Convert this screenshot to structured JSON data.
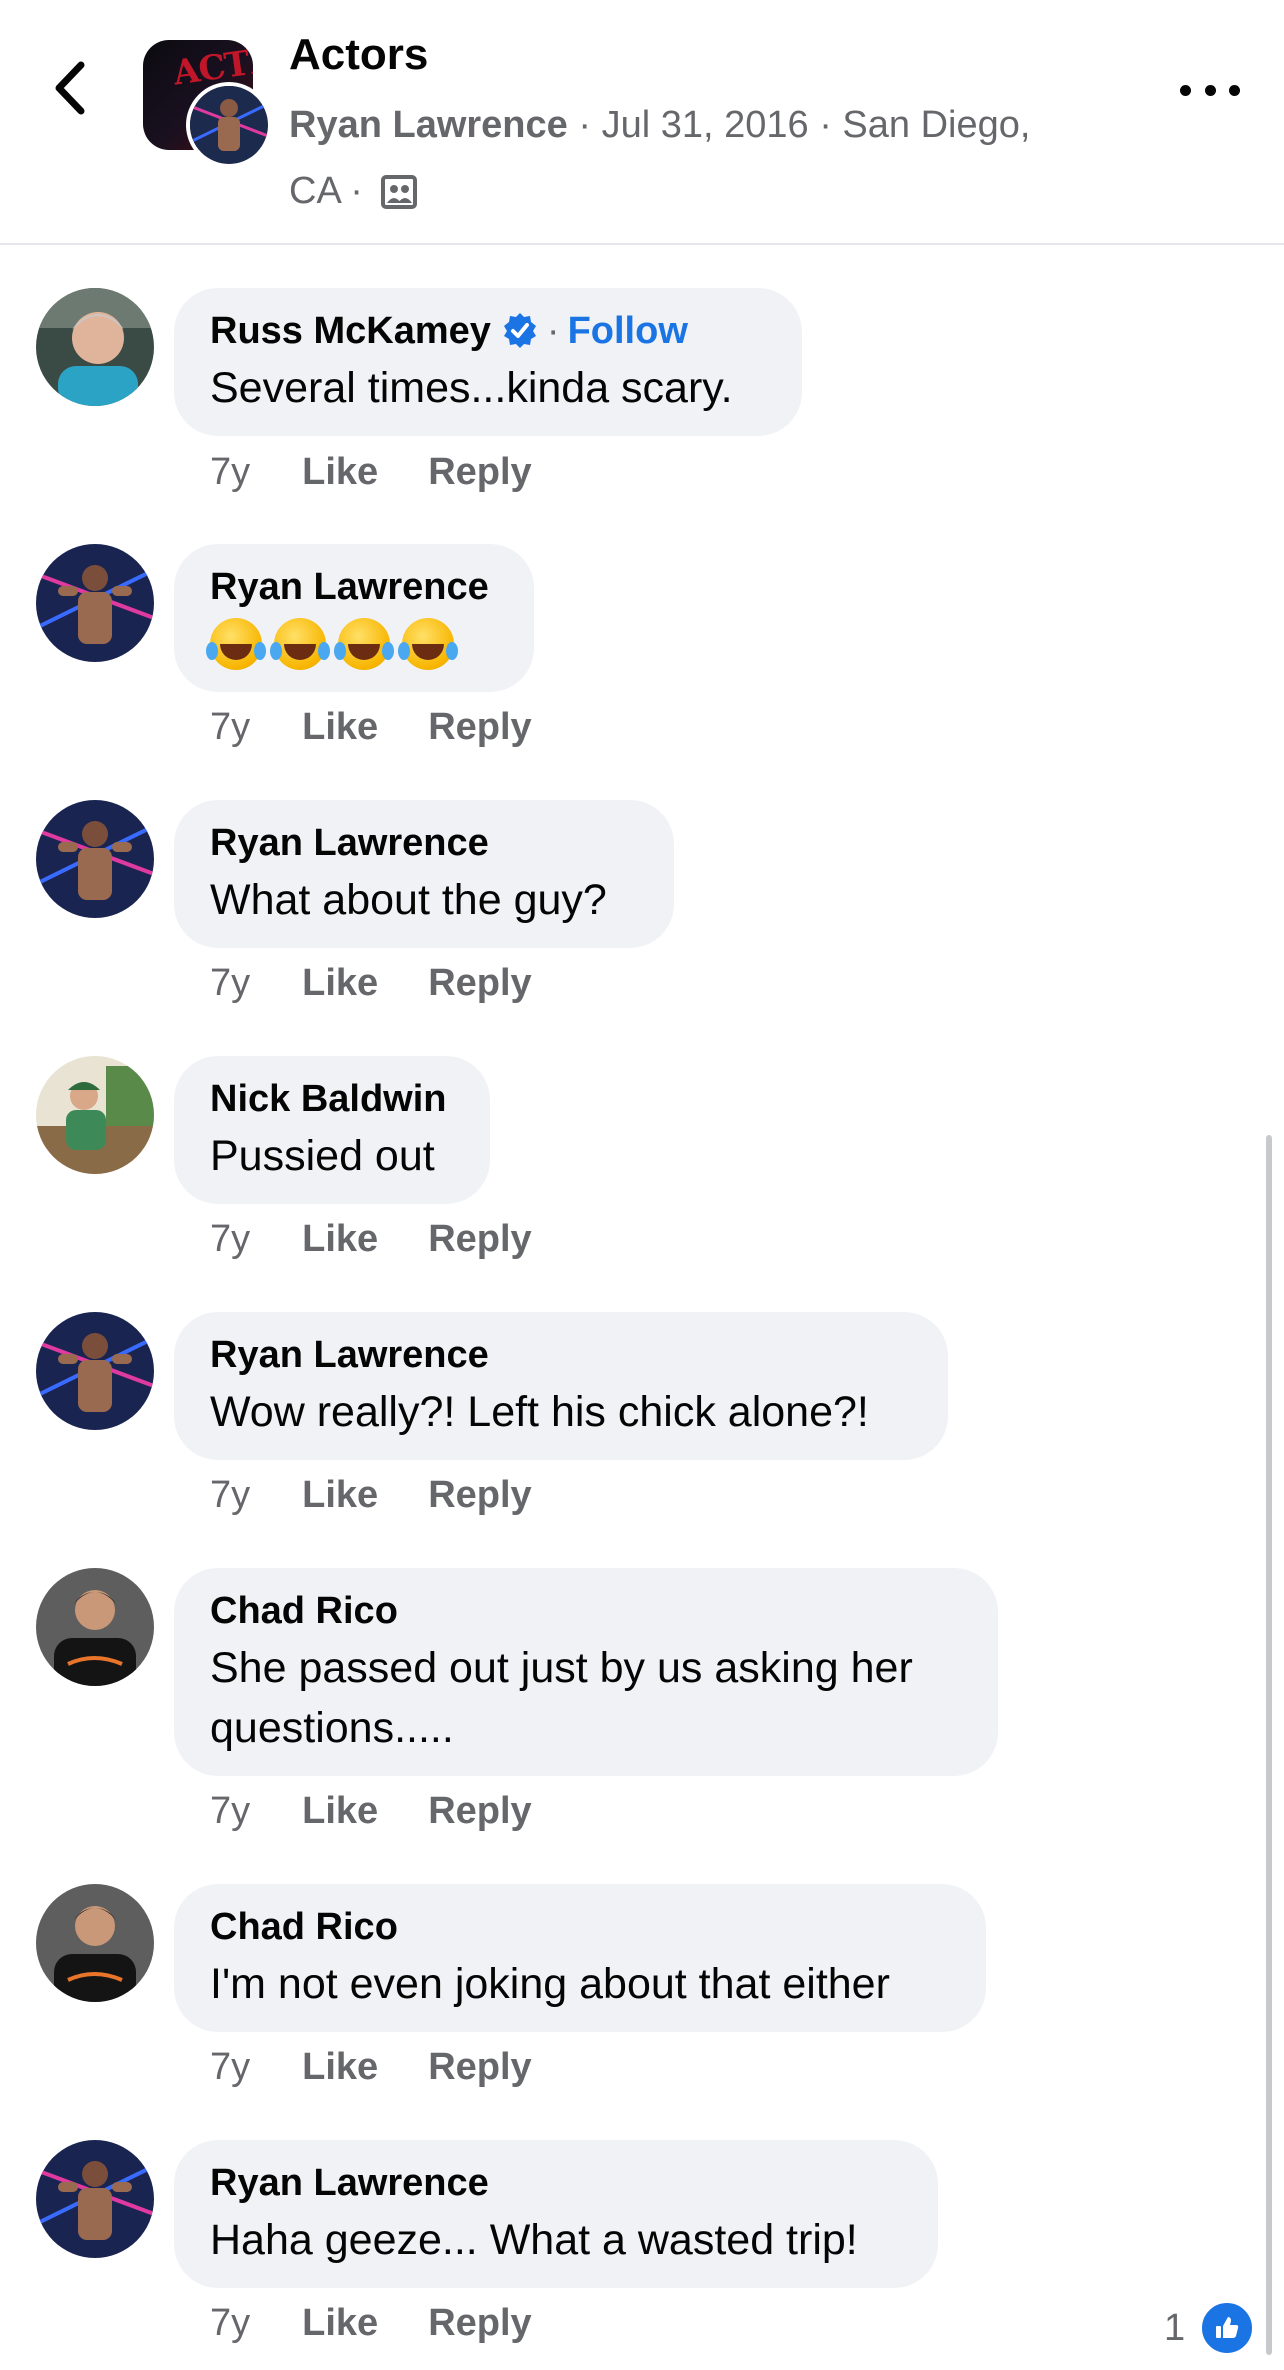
{
  "header": {
    "title": "Actors",
    "poster": "Ryan Lawrence",
    "separator": "·",
    "date": "Jul 31, 2016",
    "location_line1": "San Diego,",
    "location_line2": "CA",
    "group_avatar_text": "ACTRS"
  },
  "labels": {
    "like": "Like",
    "reply": "Reply",
    "follow": "Follow"
  },
  "comments": [
    {
      "author": "Russ McKamey",
      "verified": true,
      "text": "Several times...kinda scary.",
      "time": "7y"
    },
    {
      "author": "Ryan Lawrence",
      "text": "😂😂😂😂",
      "time": "7y"
    },
    {
      "author": "Ryan Lawrence",
      "text": "What about the guy?",
      "time": "7y"
    },
    {
      "author": "Nick Baldwin",
      "text": "Pussied out",
      "time": "7y"
    },
    {
      "author": "Ryan Lawrence",
      "text": "Wow really?! Left his chick alone?!",
      "time": "7y"
    },
    {
      "author": "Chad Rico",
      "text_line1": "She passed out just by us asking her",
      "text_line2": "questions.....",
      "time": "7y"
    },
    {
      "author": "Chad Rico",
      "text": "I'm not even joking about that either",
      "time": "7y"
    },
    {
      "author": "Ryan Lawrence",
      "text": "Haha geeze... What a wasted trip!",
      "time": "7y",
      "reaction_count": "1"
    }
  ],
  "colors": {
    "link": "#1b74e4",
    "bubble": "#f0f2f5",
    "meta": "#65676b"
  }
}
